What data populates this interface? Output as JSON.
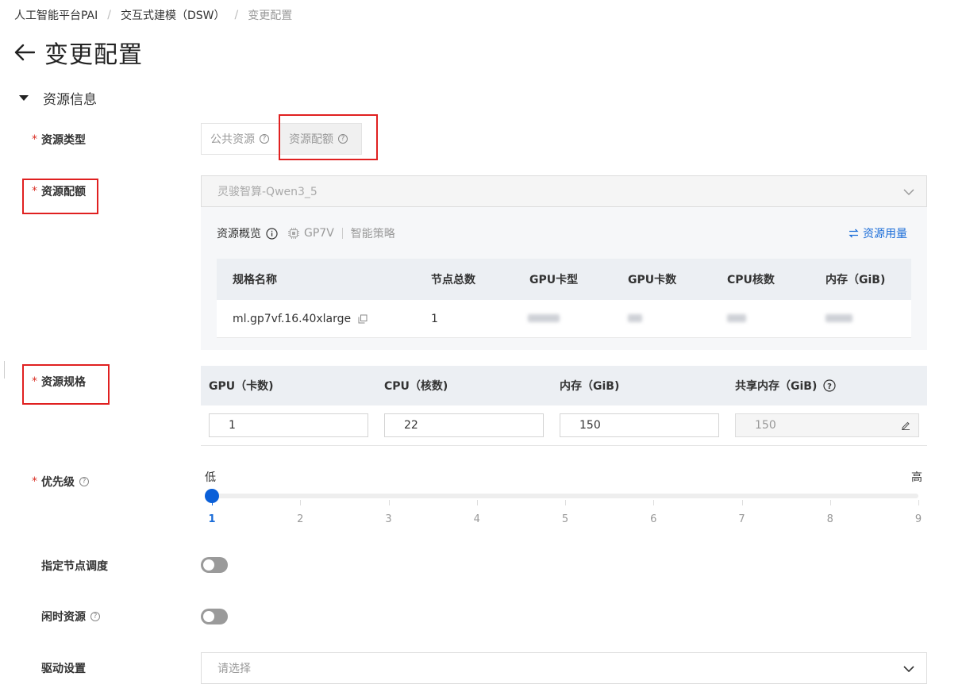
{
  "breadcrumb": {
    "item1": "人工智能平台PAI",
    "item2": "交互式建模（DSW）",
    "current": "变更配置",
    "separator": "/"
  },
  "page": {
    "title": "变更配置"
  },
  "section": {
    "title": "资源信息"
  },
  "resource_type": {
    "label": "资源类型",
    "options": [
      "公共资源",
      "资源配额"
    ],
    "selected": "资源配额"
  },
  "resource_quota": {
    "label": "资源配额",
    "value": "灵骏智算-Qwen3_5"
  },
  "overview": {
    "title": "资源概览",
    "gpu_tag": "GP7V",
    "strategy": "智能策略",
    "usage_link": "资源用量",
    "columns": [
      "规格名称",
      "节点总数",
      "GPU卡型",
      "GPU卡数",
      "CPU核数",
      "内存（GiB)"
    ],
    "row": {
      "spec_name": "ml.gp7vf.16.40xlarge",
      "node_total": "1"
    }
  },
  "resource_spec": {
    "label": "资源规格",
    "columns": [
      "GPU（卡数)",
      "CPU（核数)",
      "内存（GiB)",
      "共享内存（GiB)"
    ],
    "values": {
      "gpu": "1",
      "cpu": "22",
      "memory": "150",
      "shared_memory": "150"
    }
  },
  "priority": {
    "label": "优先级",
    "low": "低",
    "high": "高",
    "ticks": [
      "1",
      "2",
      "3",
      "4",
      "5",
      "6",
      "7",
      "8",
      "9"
    ],
    "value": 1
  },
  "node_schedule": {
    "label": "指定节点调度",
    "enabled": false
  },
  "idle_resource": {
    "label": "闲时资源",
    "enabled": false
  },
  "driver": {
    "label": "驱动设置",
    "placeholder": "请选择"
  },
  "colors": {
    "accent": "#1a6cd8",
    "required": "#d93026",
    "highlight_box": "#e02020"
  }
}
